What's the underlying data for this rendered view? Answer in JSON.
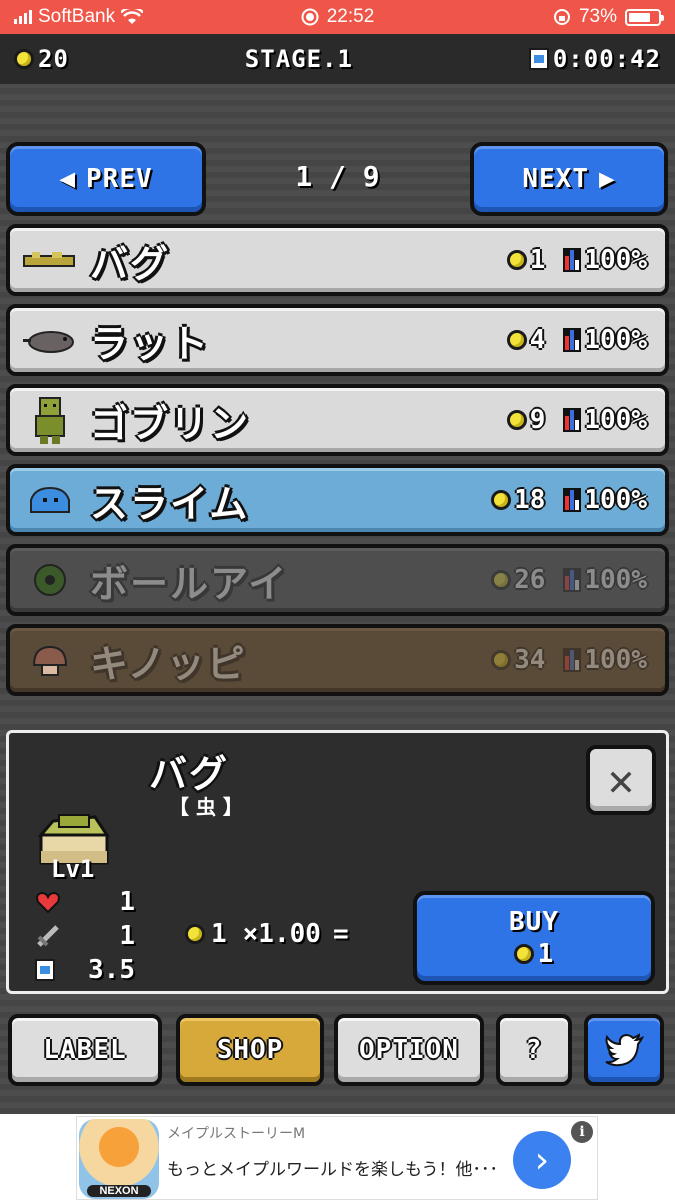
{
  "status": {
    "carrier": "SoftBank",
    "time": "22:52",
    "battery": "73%"
  },
  "header": {
    "coins": "20",
    "stage": "STAGE.1",
    "timer": "0:00:42"
  },
  "pager": {
    "prev_label": "PREV",
    "next_label": "NEXT",
    "page": "1 / 9"
  },
  "monsters": [
    {
      "name": "バグ",
      "cost": "1",
      "pct": "100%"
    },
    {
      "name": "ラット",
      "cost": "4",
      "pct": "100%"
    },
    {
      "name": "ゴブリン",
      "cost": "9",
      "pct": "100%"
    },
    {
      "name": "スライム",
      "cost": "18",
      "pct": "100%"
    },
    {
      "name": "ボールアイ",
      "cost": "26",
      "pct": "100%"
    },
    {
      "name": "キノッピ",
      "cost": "34",
      "pct": "100%"
    }
  ],
  "detail": {
    "name": "バグ",
    "category": "【 虫 】",
    "level": "Lv1",
    "hp": "1",
    "atk": "1",
    "speed": "3.5",
    "formula_cost": "1",
    "formula_mult": "×1.00",
    "formula_eq": "=",
    "buy_label": "BUY",
    "buy_cost": "1"
  },
  "tabs": {
    "label": "LABEL",
    "shop": "SHOP",
    "option": "OPTION",
    "help": "?"
  },
  "ad": {
    "title": "メイプルストーリーM",
    "text": "もっとメイプルワールドを楽しもう！他･･･",
    "brand": "NEXON",
    "info": "i",
    "arrow": "›"
  },
  "colors": {
    "status_bar": "#ef5548",
    "button_blue": "#2f74e6",
    "active_tab": "#d6a93a",
    "selected_row": "#6cacd6"
  }
}
